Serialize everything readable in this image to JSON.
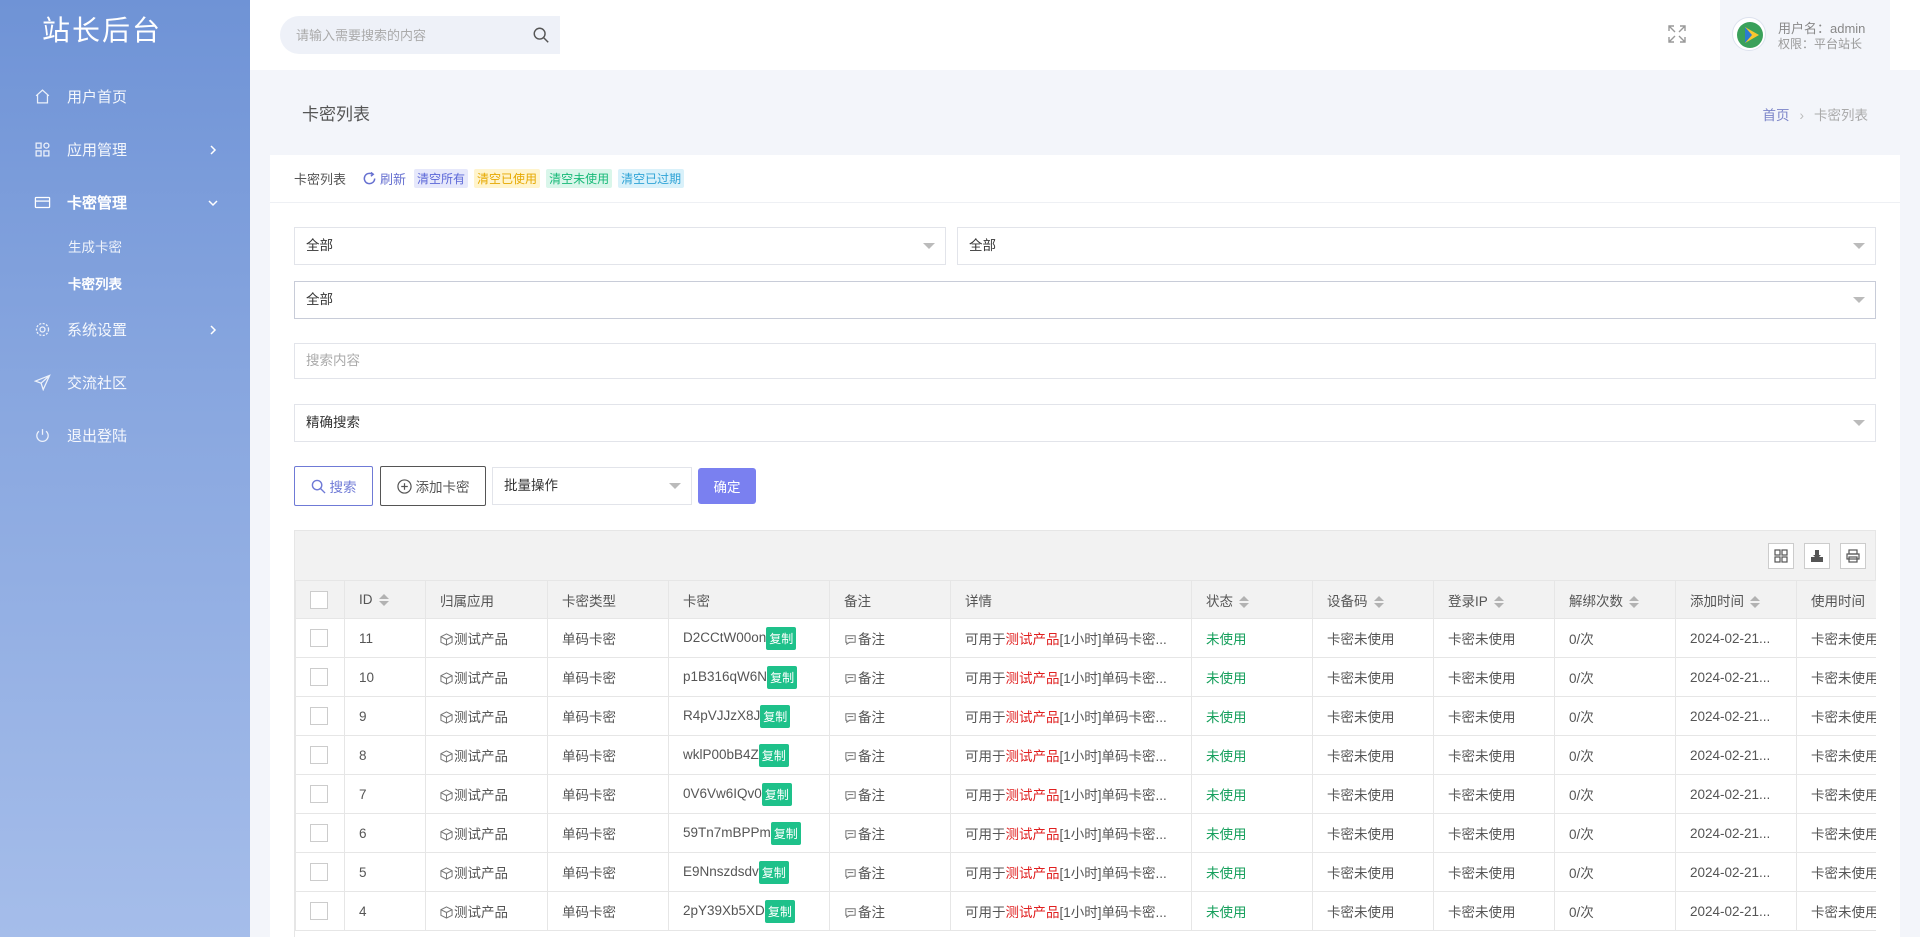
{
  "sidebar": {
    "brand": "站长后台",
    "items": [
      {
        "label": "用户首页",
        "icon": "home-icon"
      },
      {
        "label": "应用管理",
        "icon": "apps-icon"
      },
      {
        "label": "卡密管理",
        "icon": "card-icon"
      },
      {
        "label": "系统设置",
        "icon": "gear-icon"
      },
      {
        "label": "交流社区",
        "icon": "send-icon"
      },
      {
        "label": "退出登陆",
        "icon": "power-icon"
      }
    ],
    "sub_items": [
      {
        "label": "生成卡密"
      },
      {
        "label": "卡密列表"
      }
    ]
  },
  "header": {
    "search_placeholder": "请输入需要搜索的内容",
    "user_name": "用户名：admin",
    "user_role": "权限：平台站长"
  },
  "page": {
    "title": "卡密列表",
    "breadcrumb_home": "首页",
    "breadcrumb_current": "卡密列表"
  },
  "card": {
    "title": "卡密列表",
    "refresh": "刷新",
    "clear_all": "清空所有",
    "clear_used": "清空已使用",
    "clear_unused": "清空未使用",
    "clear_expired": "清空已过期"
  },
  "filters": {
    "select1": "全部",
    "select2": "全部",
    "select3": "全部",
    "search_placeholder": "搜索内容",
    "search_mode": "精确搜索"
  },
  "actions": {
    "search": "搜索",
    "add": "添加卡密",
    "batch": "批量操作",
    "confirm": "确定"
  },
  "table": {
    "headers": [
      "ID",
      "归属应用",
      "卡密类型",
      "卡密",
      "备注",
      "详情",
      "状态",
      "设备码",
      "登录IP",
      "解绑次数",
      "添加时间",
      "使用时间"
    ],
    "copy_label": "复制",
    "note_label": "备注",
    "detail_prefix": "可用于",
    "detail_app": "测试产品",
    "detail_suffix": "[1小时]单码卡密...",
    "rows": [
      {
        "id": "11",
        "app": "测试产品",
        "type": "单码卡密",
        "key": "D2CCtW00on",
        "status": "未使用",
        "device": "卡密未使用",
        "ip": "卡密未使用",
        "unbind": "0/次",
        "added": "2024-02-21...",
        "used": "卡密未使用"
      },
      {
        "id": "10",
        "app": "测试产品",
        "type": "单码卡密",
        "key": "p1B316qW6N",
        "status": "未使用",
        "device": "卡密未使用",
        "ip": "卡密未使用",
        "unbind": "0/次",
        "added": "2024-02-21...",
        "used": "卡密未使用"
      },
      {
        "id": "9",
        "app": "测试产品",
        "type": "单码卡密",
        "key": "R4pVJJzX8J",
        "status": "未使用",
        "device": "卡密未使用",
        "ip": "卡密未使用",
        "unbind": "0/次",
        "added": "2024-02-21...",
        "used": "卡密未使用"
      },
      {
        "id": "8",
        "app": "测试产品",
        "type": "单码卡密",
        "key": "wklP00bB4Z",
        "status": "未使用",
        "device": "卡密未使用",
        "ip": "卡密未使用",
        "unbind": "0/次",
        "added": "2024-02-21...",
        "used": "卡密未使用"
      },
      {
        "id": "7",
        "app": "测试产品",
        "type": "单码卡密",
        "key": "0V6Vw6IQv0",
        "status": "未使用",
        "device": "卡密未使用",
        "ip": "卡密未使用",
        "unbind": "0/次",
        "added": "2024-02-21...",
        "used": "卡密未使用"
      },
      {
        "id": "6",
        "app": "测试产品",
        "type": "单码卡密",
        "key": "59Tn7mBPPm",
        "status": "未使用",
        "device": "卡密未使用",
        "ip": "卡密未使用",
        "unbind": "0/次",
        "added": "2024-02-21...",
        "used": "卡密未使用"
      },
      {
        "id": "5",
        "app": "测试产品",
        "type": "单码卡密",
        "key": "E9Nnszdsdv",
        "status": "未使用",
        "device": "卡密未使用",
        "ip": "卡密未使用",
        "unbind": "0/次",
        "added": "2024-02-21...",
        "used": "卡密未使用"
      },
      {
        "id": "4",
        "app": "测试产品",
        "type": "单码卡密",
        "key": "2pY39Xb5XD",
        "status": "未使用",
        "device": "卡密未使用",
        "ip": "卡密未使用",
        "unbind": "0/次",
        "added": "2024-02-21...",
        "used": "卡密未使用"
      }
    ]
  },
  "colors": {
    "accent": "#7a80f0",
    "status_unused": "#17a05d",
    "app_highlight": "#e02020",
    "copy_tag": "#1ec18a"
  }
}
